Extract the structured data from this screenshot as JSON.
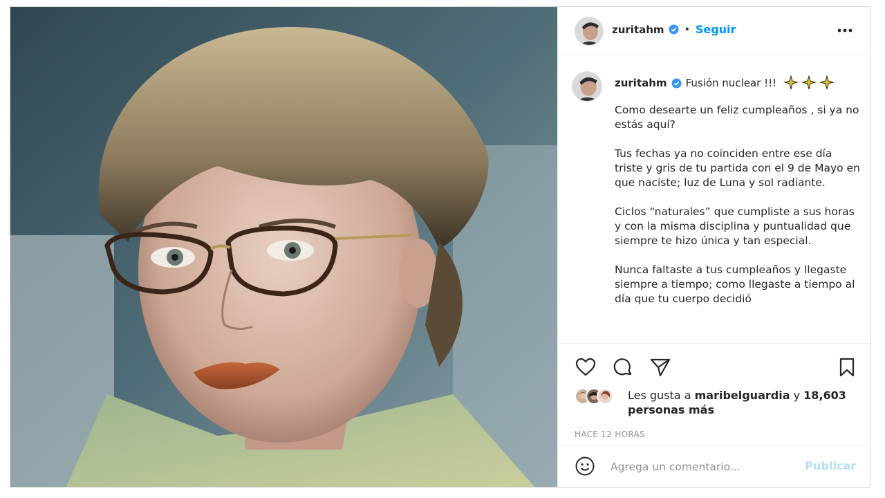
{
  "post": {
    "photo": {
      "alt_subject": "portrait-photo"
    },
    "header": {
      "username": "zuritahm",
      "separator": "•",
      "follow_label": "Seguir",
      "more_icon": "more-horizontal-icon",
      "verified_icon": "verified-badge-icon"
    },
    "caption": {
      "username": "zuritahm",
      "first_line": "Fusión nuclear !!!",
      "emoji_icons": [
        "sparkle-emoji",
        "sparkle-emoji",
        "sparkle-emoji"
      ],
      "paragraphs": [
        "Como desearte un feliz cumpleaños , si ya no estás aquí?",
        "Tus fechas ya no coinciden entre ese día triste y gris de tu partida con el 9 de Mayo en que naciste; luz de Luna y sol radiante.",
        "Ciclos “naturales” que cumpliste a sus horas y con la misma disciplina y puntualidad que siempre te hizo única y tan especial.",
        "Nunca faltaste a tus cumpleaños y llegaste siempre a tiempo; como llegaste a tiempo al día que tu cuerpo decidió"
      ]
    },
    "actions": {
      "like_icon": "heart-icon",
      "comment_icon": "comment-icon",
      "share_icon": "paper-plane-icon",
      "save_icon": "bookmark-icon"
    },
    "likes": {
      "prefix": "Les gusta a",
      "first_user": "maribelguardia",
      "connector": "y",
      "count_text": "18,603 personas más"
    },
    "timestamp": "HACE 12 HORAS",
    "comment": {
      "smile_icon": "smile-icon",
      "placeholder": "Agrega un comentario...",
      "value": "",
      "publish_label": "Publicar"
    },
    "colors": {
      "accent": "#0095f6",
      "publish_disabled": "#b2dffc",
      "text": "#262626",
      "muted": "#8e8e8e",
      "border": "#dbdbdb"
    }
  }
}
